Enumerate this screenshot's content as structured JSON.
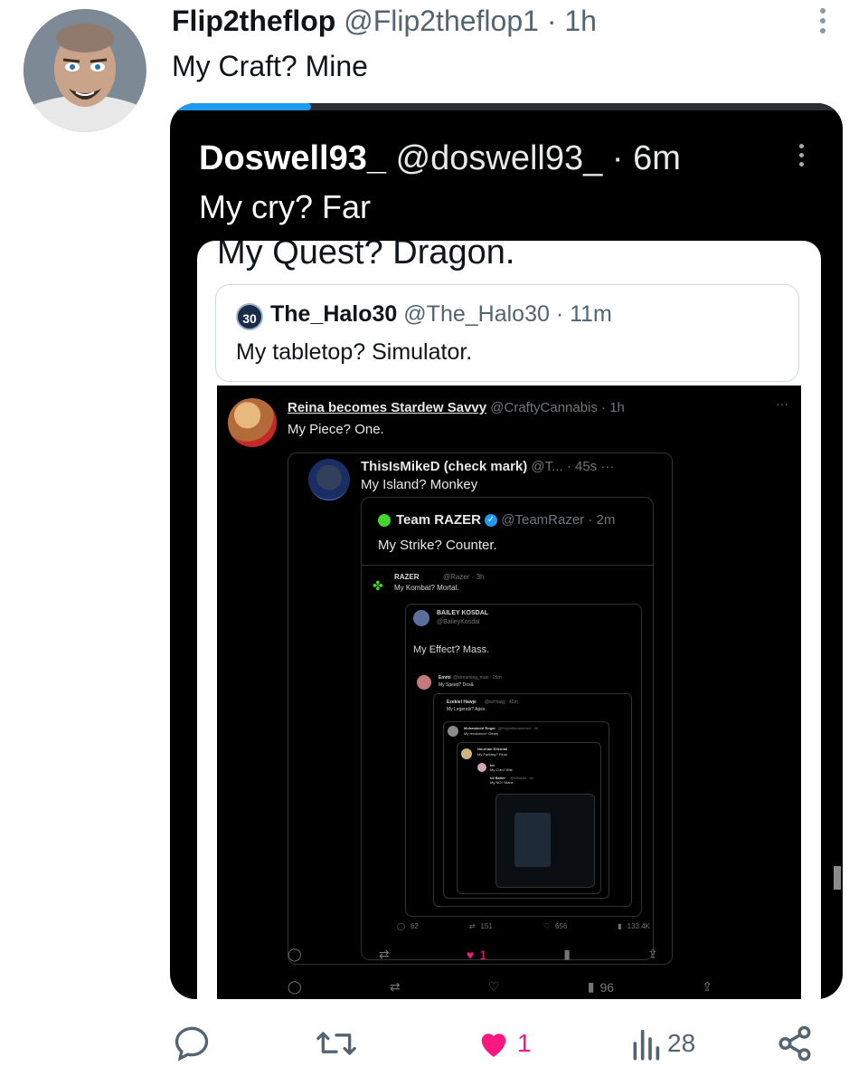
{
  "tweet": {
    "name": "Flip2theflop",
    "handle": "@Flip2theflop1",
    "separator": "·",
    "time": "1h",
    "text": "My Craft? Mine",
    "stats": {
      "likes": "1",
      "views": "28"
    }
  },
  "video": {
    "name": "Doswell93_",
    "handle": "@doswell93_",
    "separator": "·",
    "time": "6m",
    "text": "My cry? Far",
    "progress_fraction": 0.21,
    "card": {
      "top_text": "My Quest? Dragon.",
      "halo": {
        "icon_label": "30",
        "name": "The_Halo30",
        "meta": "@The_Halo30 · 11m",
        "text": "My tabletop? Simulator."
      },
      "reina": {
        "name": "Reina becomes Stardew Savvy",
        "meta": "@CraftyCannabis · 1h",
        "text": "My Piece? One.",
        "more": "···"
      },
      "mike": {
        "name": "ThisIsMikeD (check mark)",
        "meta": "@T... · 45s",
        "more": "···",
        "text": "My Island? Monkey"
      },
      "team_razer": {
        "name": "Team RAZER",
        "meta": "@TeamRazer · 2m",
        "text": "My Strike? Counter."
      },
      "razer": {
        "name": "RAZER",
        "meta": "@Razer · 3h",
        "text": "My Kombat? Mortal."
      },
      "bailey": {
        "name": "BAILEY KOSDAL",
        "handle": "@BaileyKosdal",
        "text": "My Effect? Mass."
      },
      "deeper": {
        "line1_name": "Emmi",
        "line1_meta": "@streaming_man · 25m",
        "line1_text": "My Speed? Dos&",
        "line2_name": "Ezekiel Hawje",
        "line2_meta": "@ezHawjj · 45m",
        "line2_text": "My Legends? Apex.",
        "line3_name": "Mohammed Rogar",
        "line3_meta": "@RogarMohammed · 4h",
        "line3_text": "My revolution? Gears",
        "line4_name": "Nourhan Elfendal",
        "line4_text": "My Fantasy? Final",
        "line5_name": "lol",
        "line5_text": "My Coin? Bits",
        "line6_name": "hll Bailer",
        "line6_meta": "@hllBailer · 5h",
        "line6_text": "My NO? Mans"
      },
      "mike_actions": {
        "replies": "62",
        "retweets": "151",
        "likes": "656",
        "views": "133.4K"
      },
      "mike_actions_bottom": {
        "likes": "1"
      },
      "reina_actions": {
        "views": "96"
      }
    }
  },
  "colors": {
    "accent_blue": "#1d9bf0",
    "like_pink": "#f91880",
    "muted": "#536471",
    "razer_green": "#44d62c"
  }
}
